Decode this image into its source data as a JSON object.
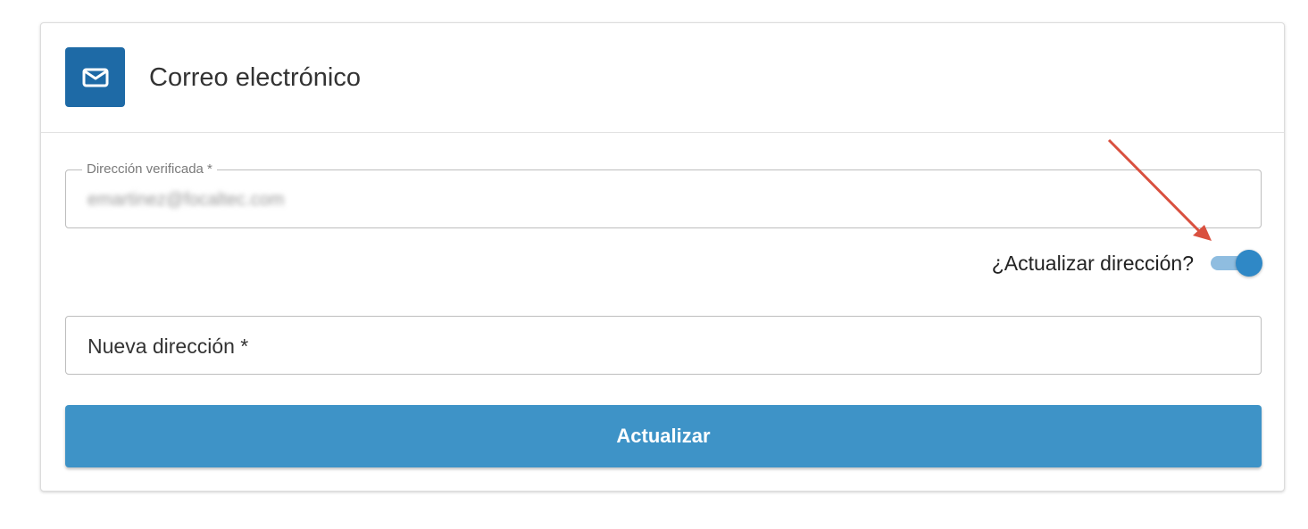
{
  "card": {
    "title": "Correo electrónico",
    "icon": "mail-icon",
    "icon_bg_color": "#1e6aa6"
  },
  "verified_field": {
    "label": "Dirección verificada *",
    "value": "emartinez@focaltec.com"
  },
  "update_toggle": {
    "label": "¿Actualizar dirección?",
    "checked": true,
    "color": "#2f88c6"
  },
  "new_address_field": {
    "placeholder": "Nueva dirección *",
    "value": ""
  },
  "update_button": {
    "label": "Actualizar",
    "color": "#3e93c7"
  },
  "annotation": {
    "icon": "red-arrow-icon",
    "color": "#d9503f"
  }
}
